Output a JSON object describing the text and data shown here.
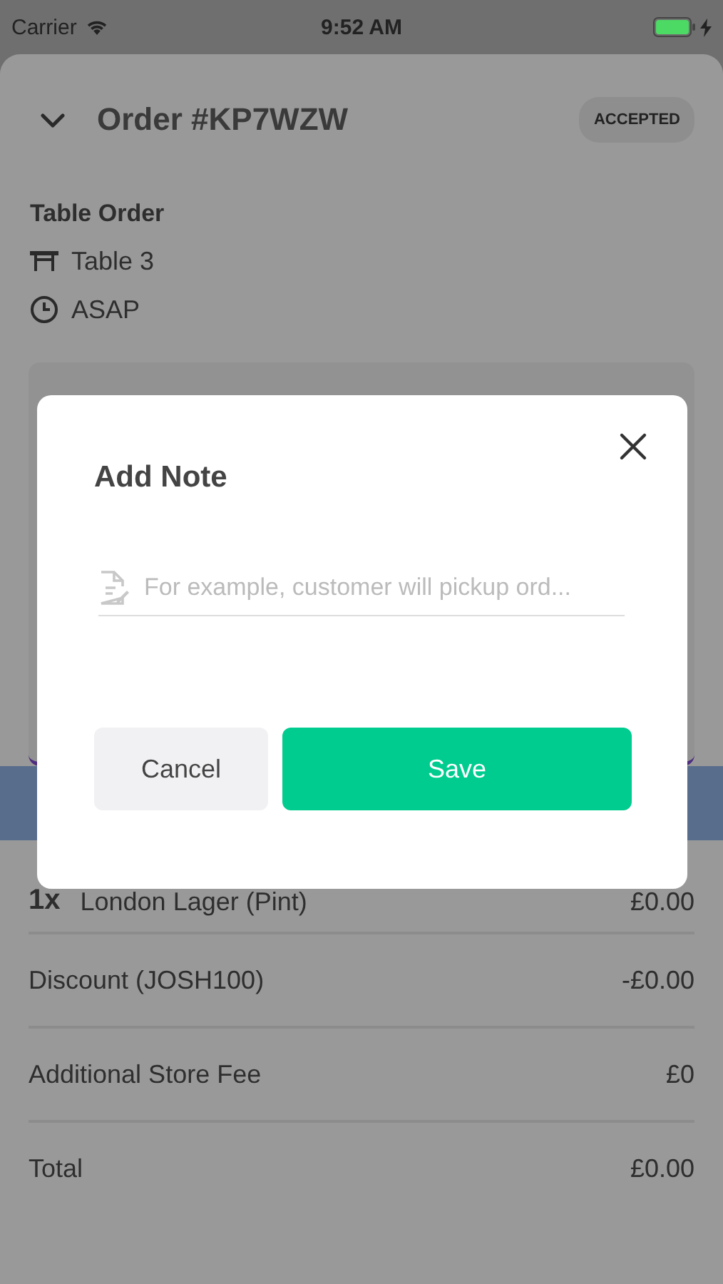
{
  "status_bar": {
    "carrier": "Carrier",
    "time": "9:52 AM",
    "charging": true
  },
  "order": {
    "title": "Order #KP7WZW",
    "status": "ACCEPTED",
    "type": "Table Order",
    "table": "Table 3",
    "time": "ASAP"
  },
  "line_items": [
    {
      "kind": "item",
      "quantity": "1x",
      "label": "London Lager (Pint)",
      "amount": "£0.00"
    },
    {
      "kind": "summary",
      "label": "Discount (JOSH100)",
      "amount": "-£0.00"
    },
    {
      "kind": "summary",
      "label": "Additional Store Fee",
      "amount": "£0"
    },
    {
      "kind": "summary",
      "label": "Total",
      "amount": "£0.00"
    }
  ],
  "dialog": {
    "title": "Add Note",
    "placeholder": "For example, customer will pickup ord...",
    "buttons": [
      {
        "kind": "secondary",
        "label": "Cancel"
      },
      {
        "kind": "primary",
        "label": "Save"
      }
    ]
  }
}
